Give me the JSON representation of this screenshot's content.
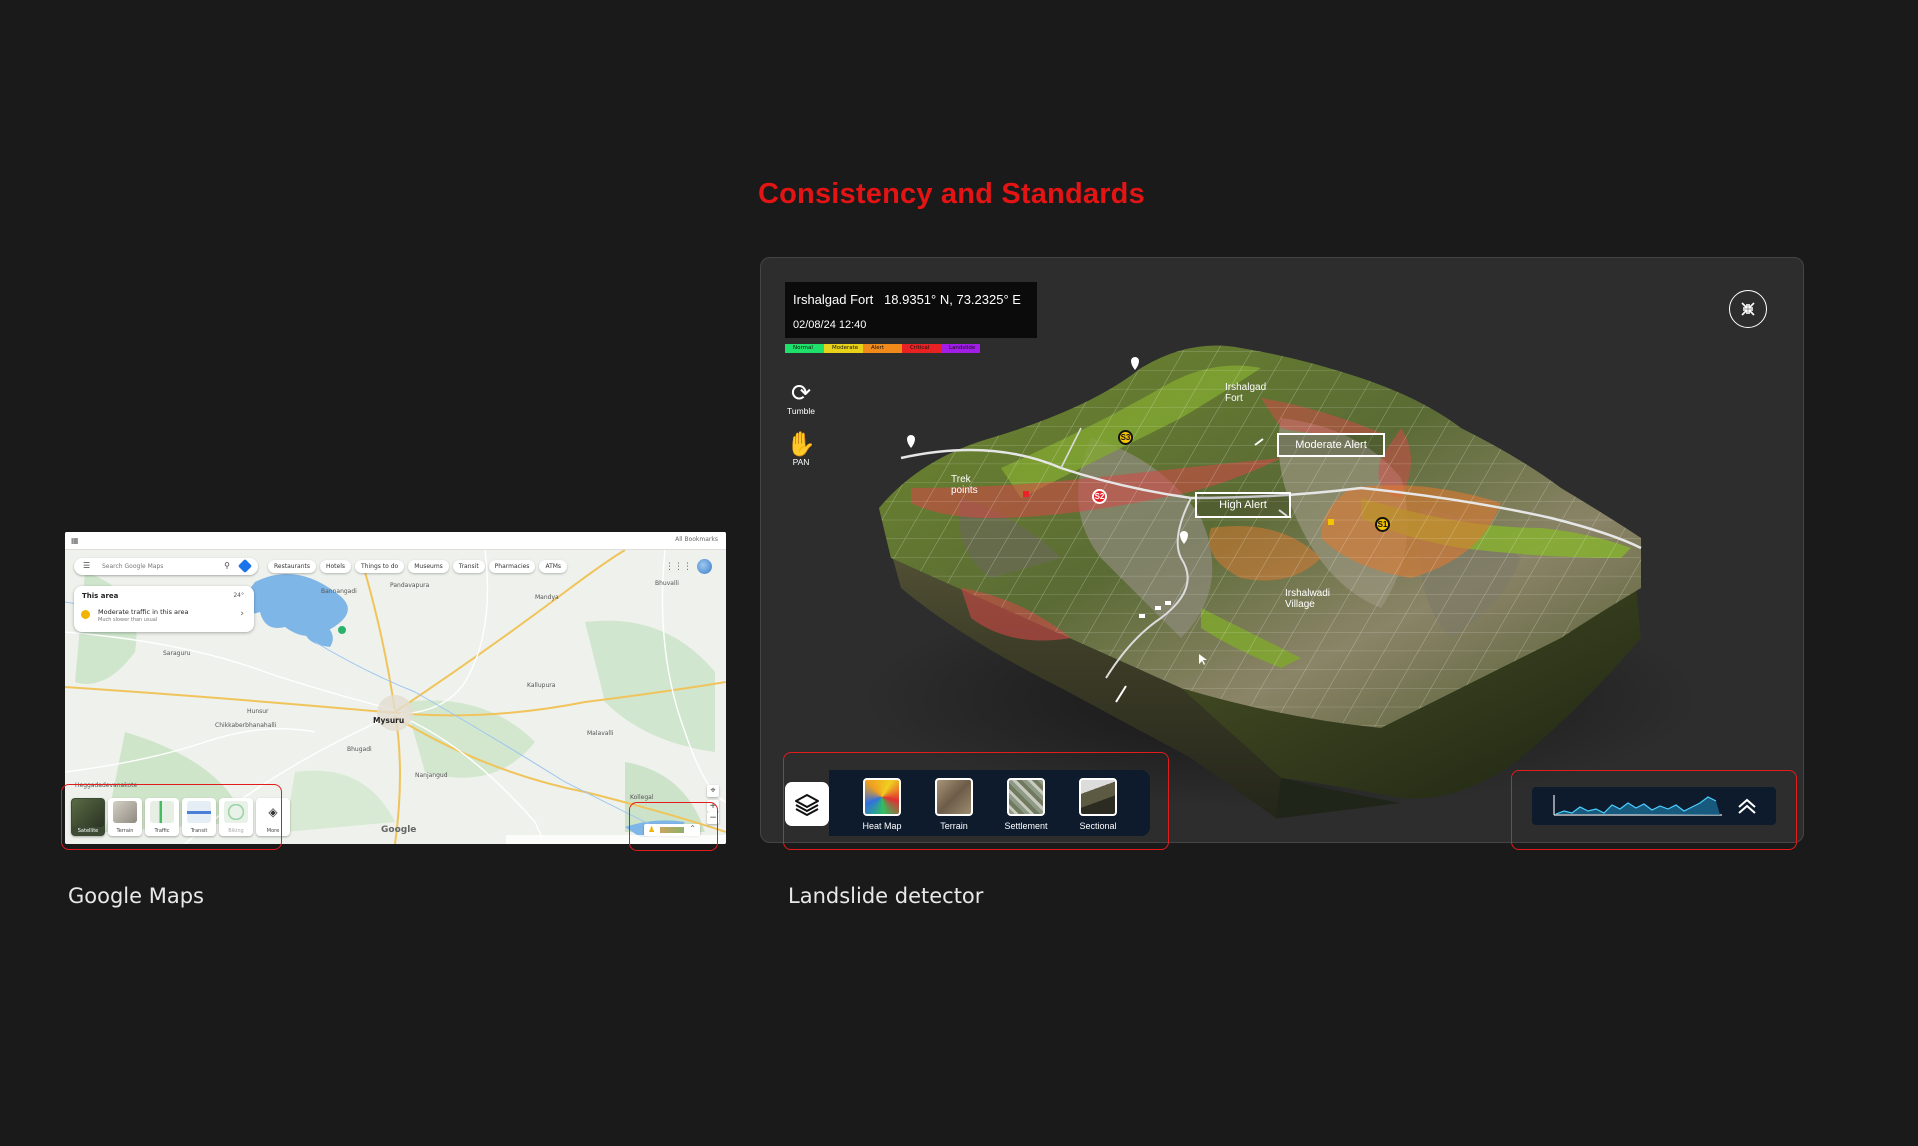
{
  "heading": "Consistency and Standards",
  "captions": {
    "google_maps": "Google Maps",
    "landslide": "Landslide detector"
  },
  "google_maps": {
    "bookmarks": "All Bookmarks",
    "search_placeholder": "Search Google Maps",
    "chips": [
      "Restaurants",
      "Hotels",
      "Things to do",
      "Museums",
      "Transit",
      "Pharmacies",
      "ATMs"
    ],
    "card": {
      "title": "This area",
      "temperature": "24°",
      "traffic": "Moderate traffic in this area",
      "traffic_sub": "Much slower than usual"
    },
    "layers": [
      "Satellite",
      "Terrain",
      "Traffic",
      "Transit",
      "Biking",
      "More"
    ],
    "logo": "Google",
    "places": [
      {
        "name": "Bannangadi"
      },
      {
        "name": "Pandavapura"
      },
      {
        "name": "Mandya"
      },
      {
        "name": "Bhuvalli"
      },
      {
        "name": "Saraguru"
      },
      {
        "name": "Mysuru",
        "big": true
      },
      {
        "name": "Hunsur"
      },
      {
        "name": "Chikkaberbhanahalli"
      },
      {
        "name": "Bhugadi"
      },
      {
        "name": "Heggadadevanakote"
      },
      {
        "name": "Nanjangud"
      },
      {
        "name": "Malavalli"
      },
      {
        "name": "Kollegal"
      },
      {
        "name": "Kallupura"
      }
    ]
  },
  "landslide": {
    "location": "Irshalgad Fort",
    "coords": "18.9351° N, 73.2325° E",
    "datetime": "02/08/24  12:40",
    "legend": [
      {
        "label": "Normal",
        "color": "#1fe06a"
      },
      {
        "label": "Moderate",
        "color": "#e8d21a"
      },
      {
        "label": "Alert",
        "color": "#f08a1a"
      },
      {
        "label": "Critical",
        "color": "#e82222"
      },
      {
        "label": "Landslide",
        "color": "#a21ee8"
      }
    ],
    "tools": {
      "tumble": "Tumble",
      "pan": "PAN"
    },
    "map_labels": {
      "fort": "Irshalgad\nFort",
      "trek": "Trek\npoints",
      "village": "Irshalwadi\nVillage"
    },
    "alerts": {
      "moderate": "Moderate  Alert",
      "high": "High Alert"
    },
    "sensors": {
      "s1": "S1",
      "s2": "S2",
      "s3": "S3"
    },
    "layer_options": [
      "Heat Map",
      "Terrain",
      "Settlement",
      "Sectional"
    ]
  },
  "colors": {
    "accent_red": "#e41414",
    "panel_navy": "#0d1b2d",
    "page_bg": "#1a1a1a"
  }
}
